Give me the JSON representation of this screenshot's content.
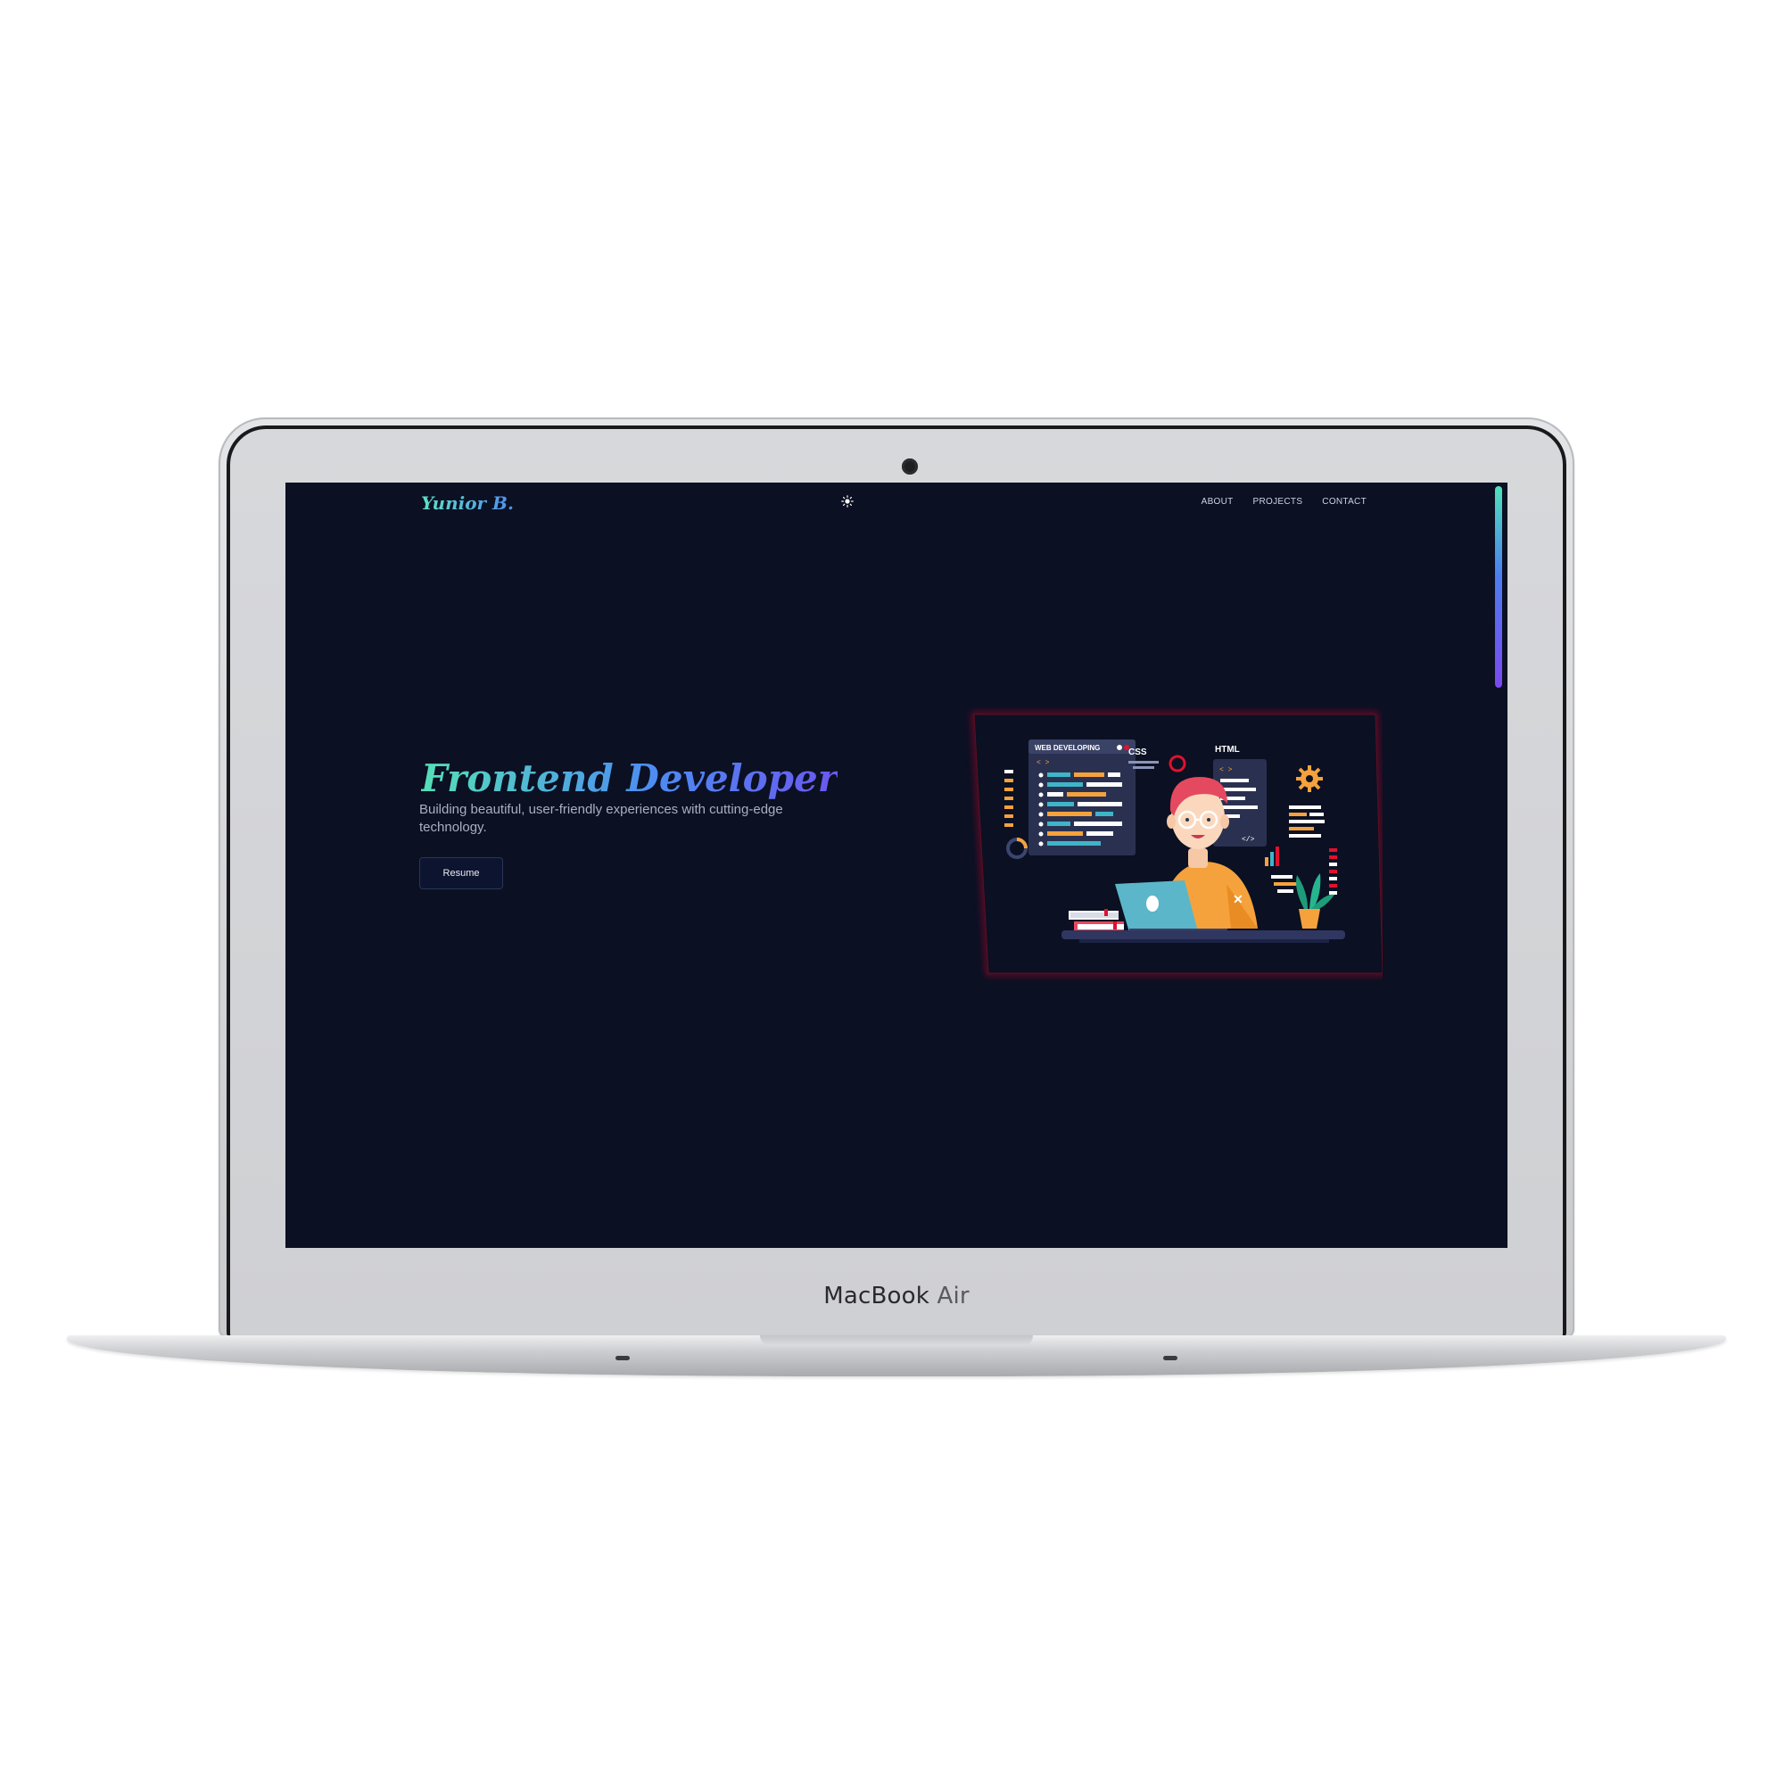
{
  "device": {
    "brand": "MacBook",
    "model": "Air"
  },
  "nav": {
    "logo": "Yunior B.",
    "theme_icon": "sun-icon",
    "links": [
      "ABOUT",
      "PROJECTS",
      "CONTACT"
    ]
  },
  "hero": {
    "title": "Frontend Developer",
    "subtitle": "Building beautiful, user-friendly experiences with cutting-edge technology.",
    "button_label": "Resume"
  },
  "illustration": {
    "labels": {
      "web": "WEB DEVELOPING",
      "css": "CSS",
      "html": "HTML",
      "tag_open": "< >",
      "tag_close": "</>"
    }
  },
  "colors": {
    "background": "#0b1023",
    "accent_green": "#55e0b8",
    "accent_blue": "#4d8df2",
    "accent_purple": "#6a58ef",
    "frame_glow": "#e0112e"
  }
}
